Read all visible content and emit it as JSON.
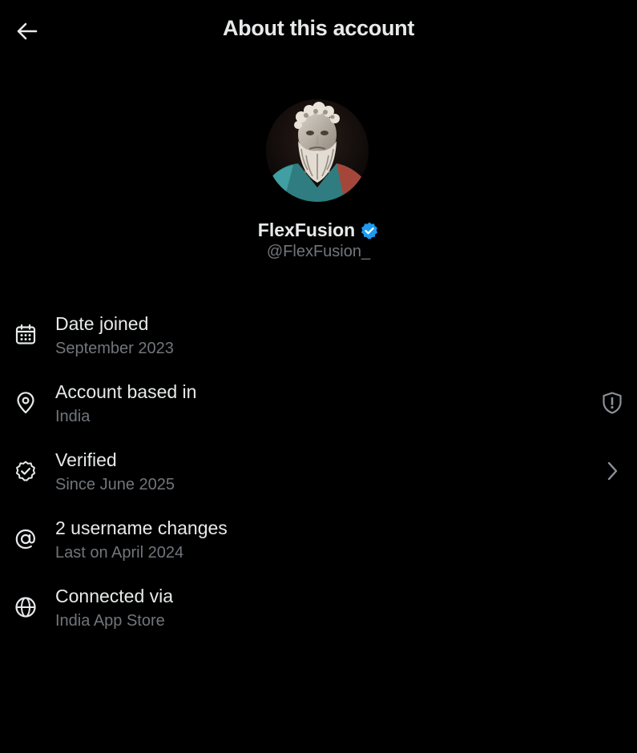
{
  "header": {
    "title": "About this account",
    "back_icon": "arrow-left-icon"
  },
  "profile": {
    "display_name": "FlexFusion",
    "handle": "@FlexFusion_",
    "verified": true,
    "badge_color": "#1d9bf0",
    "avatar": "marble-bust-avatar"
  },
  "rows": [
    {
      "icon": "calendar-icon",
      "title": "Date joined",
      "subtitle": "September 2023"
    },
    {
      "icon": "location-pin-icon",
      "title": "Account based in",
      "subtitle": "India",
      "trailing_icon": "shield-alert-icon"
    },
    {
      "icon": "verified-check-icon",
      "title": "Verified",
      "subtitle": "Since June 2025",
      "trailing_icon": "chevron-right-icon"
    },
    {
      "icon": "at-sign-icon",
      "title": "2 username changes",
      "subtitle": "Last on April 2024"
    },
    {
      "icon": "globe-icon",
      "title": "Connected via",
      "subtitle": "India App Store"
    }
  ],
  "colors": {
    "background": "#000000",
    "primary_text": "#e7e9ea",
    "secondary_text": "#71767b",
    "accent": "#1d9bf0"
  }
}
